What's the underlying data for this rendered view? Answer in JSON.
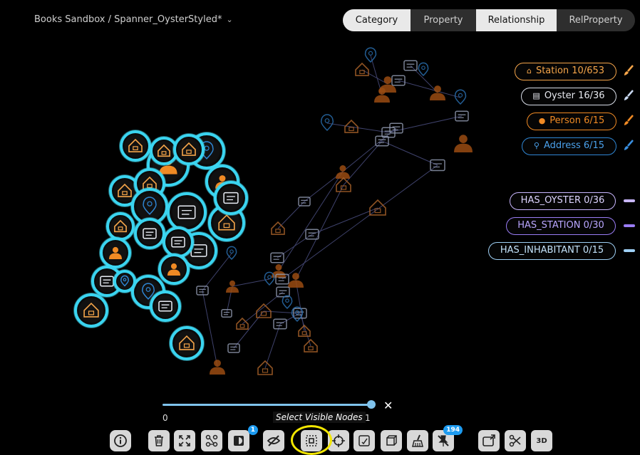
{
  "breadcrumb": {
    "text": "Books Sandbox / Spanner_OysterStyled*"
  },
  "tabs": [
    {
      "label": "Category",
      "active": true
    },
    {
      "label": "Property",
      "active": false
    },
    {
      "label": "Relationship",
      "active": true
    },
    {
      "label": "RelProperty",
      "active": false
    }
  ],
  "legend": {
    "categories": [
      {
        "label": "Station 10/653",
        "icon": "station-icon",
        "color": "#f5a54a"
      },
      {
        "label": "Oyster 16/36",
        "icon": "oyster-card-icon",
        "color": "#d8dde8"
      },
      {
        "label": "Person 6/15",
        "icon": "person-icon",
        "color": "#f08a24"
      },
      {
        "label": "Address 6/15",
        "icon": "location-pin-icon",
        "color": "#2f86d4"
      }
    ],
    "relationships": [
      {
        "label": "HAS_OYSTER 0/36",
        "color": "#c9b7ff"
      },
      {
        "label": "HAS_STATION 0/30",
        "color": "#9a7cf5"
      },
      {
        "label": "HAS_INHABITANT 0/15",
        "color": "#9fd0f5"
      }
    ]
  },
  "slider": {
    "min": "0",
    "max": "1",
    "value": 1
  },
  "tooltip": "Select Visible Nodes",
  "toolbar": {
    "buttons": [
      {
        "icon": "info-icon"
      },
      {
        "icon": "trash-icon"
      },
      {
        "icon": "expand-icon"
      },
      {
        "icon": "graph-layout-icon"
      },
      {
        "icon": "contrast-icon",
        "badge": "1"
      },
      {
        "icon": "hide-icon"
      },
      {
        "icon": "select-visible-nodes-icon"
      },
      {
        "icon": "crosshair-icon"
      },
      {
        "icon": "select-box-icon"
      },
      {
        "icon": "cube-frame-icon"
      },
      {
        "icon": "broom-icon"
      },
      {
        "icon": "unpin-icon",
        "badge": "194"
      },
      {
        "icon": "screen-share-icon"
      },
      {
        "icon": "scissors-icon"
      },
      {
        "icon": "3d-toggle-icon",
        "label": "3D"
      }
    ]
  }
}
